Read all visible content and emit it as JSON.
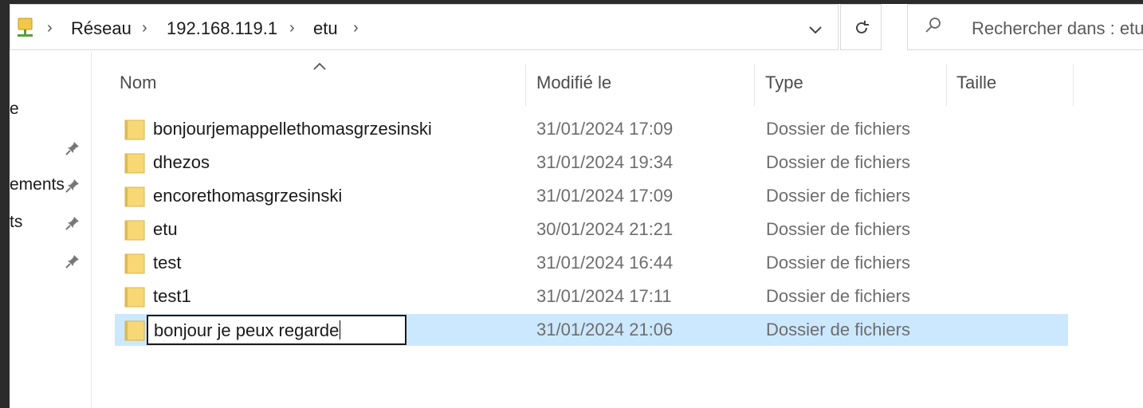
{
  "address_bar": {
    "crumbs": [
      "Réseau",
      "192.168.119.1",
      "etu"
    ]
  },
  "search": {
    "placeholder": "Rechercher dans : etu"
  },
  "nav": {
    "items": [
      "e",
      "ements",
      "ts"
    ]
  },
  "columns": {
    "name": "Nom",
    "modified": "Modifié le",
    "type": "Type",
    "size": "Taille"
  },
  "files": [
    {
      "name": "bonjourjemappellethomasgrzesinski",
      "modified": "31/01/2024 17:09",
      "type": "Dossier de fichiers"
    },
    {
      "name": "dhezos",
      "modified": "31/01/2024 19:34",
      "type": "Dossier de fichiers"
    },
    {
      "name": "encorethomasgrzesinski",
      "modified": "31/01/2024 17:09",
      "type": "Dossier de fichiers"
    },
    {
      "name": "etu",
      "modified": "30/01/2024 21:21",
      "type": "Dossier de fichiers"
    },
    {
      "name": "test",
      "modified": "31/01/2024 16:44",
      "type": "Dossier de fichiers"
    },
    {
      "name": "test1",
      "modified": "31/01/2024 17:11",
      "type": "Dossier de fichiers"
    },
    {
      "name": "bonjour je peux regarde",
      "modified": "31/01/2024 21:06",
      "type": "Dossier de fichiers",
      "editing": true
    }
  ],
  "icons": {
    "network": "network-drive-icon",
    "folder": "folder-icon",
    "pin": "pin-icon",
    "refresh": "refresh-icon",
    "search": "search-icon",
    "dropdown": "chevron-down-icon"
  },
  "colors": {
    "selection": "#cce8ff",
    "folder": "#f8d775"
  }
}
